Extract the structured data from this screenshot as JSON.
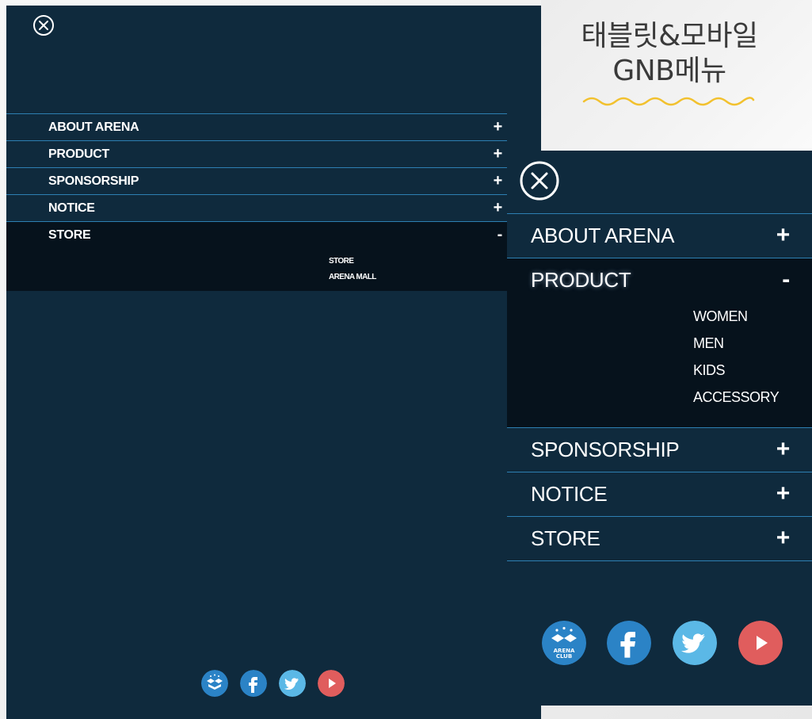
{
  "header": {
    "title_line1": "태블릿&모바일",
    "title_line2": "GNB메뉴"
  },
  "tablet": {
    "close_icon": "close-circle-icon",
    "menu": [
      {
        "label": "ABOUT ARENA",
        "sign": "+"
      },
      {
        "label": "PRODUCT",
        "sign": "+"
      },
      {
        "label": "SPONSORSHIP",
        "sign": "+"
      },
      {
        "label": "NOTICE",
        "sign": "+"
      },
      {
        "label": "STORE",
        "sign": "-"
      }
    ],
    "submenu": [
      "STORE",
      "ARENA MALL"
    ],
    "social": [
      {
        "name": "arena-club-icon",
        "color": "#2b83c6"
      },
      {
        "name": "facebook-icon",
        "color": "#2b83c6"
      },
      {
        "name": "twitter-icon",
        "color": "#5bb8e6"
      },
      {
        "name": "youtube-icon",
        "color": "#e05d5d"
      }
    ]
  },
  "mobile": {
    "close_icon": "close-circle-icon",
    "menu": [
      {
        "label": "ABOUT ARENA",
        "sign": "+"
      },
      {
        "label": "PRODUCT",
        "sign": "-"
      },
      {
        "label": "SPONSORSHIP",
        "sign": "+"
      },
      {
        "label": "NOTICE",
        "sign": "+"
      },
      {
        "label": "STORE",
        "sign": "+"
      }
    ],
    "submenu": [
      "WOMEN",
      "MEN",
      "KIDS",
      "ACCESSORY"
    ],
    "arena_club_text": [
      "ARENA",
      "CLUB"
    ],
    "social": [
      {
        "name": "arena-club-icon",
        "color": "#2b83c6"
      },
      {
        "name": "facebook-icon",
        "color": "#2b83c6"
      },
      {
        "name": "twitter-icon",
        "color": "#5bb8e6"
      },
      {
        "name": "youtube-icon",
        "color": "#e05d5d"
      }
    ]
  },
  "colors": {
    "panel": "#0f2a3d",
    "divider": "#2d7fb2",
    "open_bg": "#06121c",
    "wave": "#f2c12e"
  }
}
